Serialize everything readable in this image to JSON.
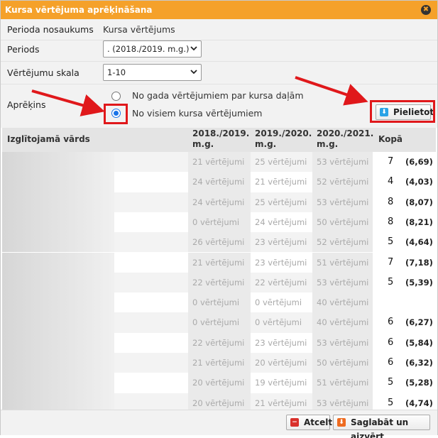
{
  "dialog": {
    "title": "Kursa vērtējuma aprēķināšana",
    "close_symbol": "✖"
  },
  "form": {
    "period_name_label": "Perioda nosaukums",
    "period_name_value": "Kursa vērtējums",
    "periods_label": "Periods",
    "periods_value": ". (2018./2019. m.g.)",
    "scale_label": "Vērtējumu skala",
    "scale_value": "1-10",
    "calc_label": "Aprēķins",
    "calc_options": [
      {
        "label": "No gada vērtējumiem par kursa daļām",
        "checked": false
      },
      {
        "label": "No visiem kursa vērtējumiem",
        "checked": true
      }
    ],
    "apply_label": "Pielietot"
  },
  "table": {
    "headers": {
      "name": "Izglītojamā vārds",
      "y1": "2018./2019.\nm.g.",
      "y2": "2019./2020.\nm.g.",
      "y3": "2020./2021.\nm.g.",
      "total": "Kopā"
    },
    "rows": [
      {
        "y1": "21 vērtējumi",
        "y2": "25 vērtējumi",
        "y3": "53 vērtējumi",
        "mark": "7",
        "avg": "(6,69)"
      },
      {
        "y1": "24 vērtējumi",
        "y2": "21 vērtējumi",
        "y3": "52 vērtējumi",
        "mark": "4",
        "avg": "(4,03)"
      },
      {
        "y1": "24 vērtējumi",
        "y2": "25 vērtējumi",
        "y3": "53 vērtējumi",
        "mark": "8",
        "avg": "(8,07)"
      },
      {
        "y1": "0 vērtējumi",
        "y2": "24 vērtējumi",
        "y3": "50 vērtējumi",
        "mark": "8",
        "avg": "(8,21)"
      },
      {
        "y1": "26 vērtējumi",
        "y2": "23 vērtējumi",
        "y3": "52 vērtējumi",
        "mark": "5",
        "avg": "(4,64)"
      },
      {
        "y1": "21 vērtējumi",
        "y2": "23 vērtējumi",
        "y3": "51 vērtējumi",
        "mark": "7",
        "avg": "(7,18)"
      },
      {
        "y1": "22 vērtējumi",
        "y2": "22 vērtējumi",
        "y3": "53 vērtējumi",
        "mark": "5",
        "avg": "(5,39)"
      },
      {
        "y1": "0 vērtējumi",
        "y2": "0 vērtējumi",
        "y3": "40 vērtējumi",
        "mark": "",
        "avg": ""
      },
      {
        "y1": "0 vērtējumi",
        "y2": "0 vērtējumi",
        "y3": "40 vērtējumi",
        "mark": "6",
        "avg": "(6,27)"
      },
      {
        "y1": "22 vērtējumi",
        "y2": "23 vērtējumi",
        "y3": "53 vērtējumi",
        "mark": "6",
        "avg": "(5,84)"
      },
      {
        "y1": "21 vērtējumi",
        "y2": "20 vērtējumi",
        "y3": "50 vērtējumi",
        "mark": "6",
        "avg": "(6,32)"
      },
      {
        "y1": "20 vērtējumi",
        "y2": "19 vērtējumi",
        "y3": "51 vērtējumi",
        "mark": "5",
        "avg": "(5,28)"
      },
      {
        "y1": "20 vērtējumi",
        "y2": "21 vērtējumi",
        "y3": "53 vērtējumi",
        "mark": "5",
        "avg": "(4,74)"
      }
    ]
  },
  "footer": {
    "cancel_label": "Atcelt",
    "save_label": "Saglabāt un aizvērt"
  },
  "colors": {
    "title_bar": "#f5a12a",
    "annotation_red": "#e0181b",
    "radio_blue": "#1a73e8",
    "apply_icon": "#2aa3e6",
    "cancel_icon": "#d9302b",
    "save_icon": "#ee6b20"
  }
}
